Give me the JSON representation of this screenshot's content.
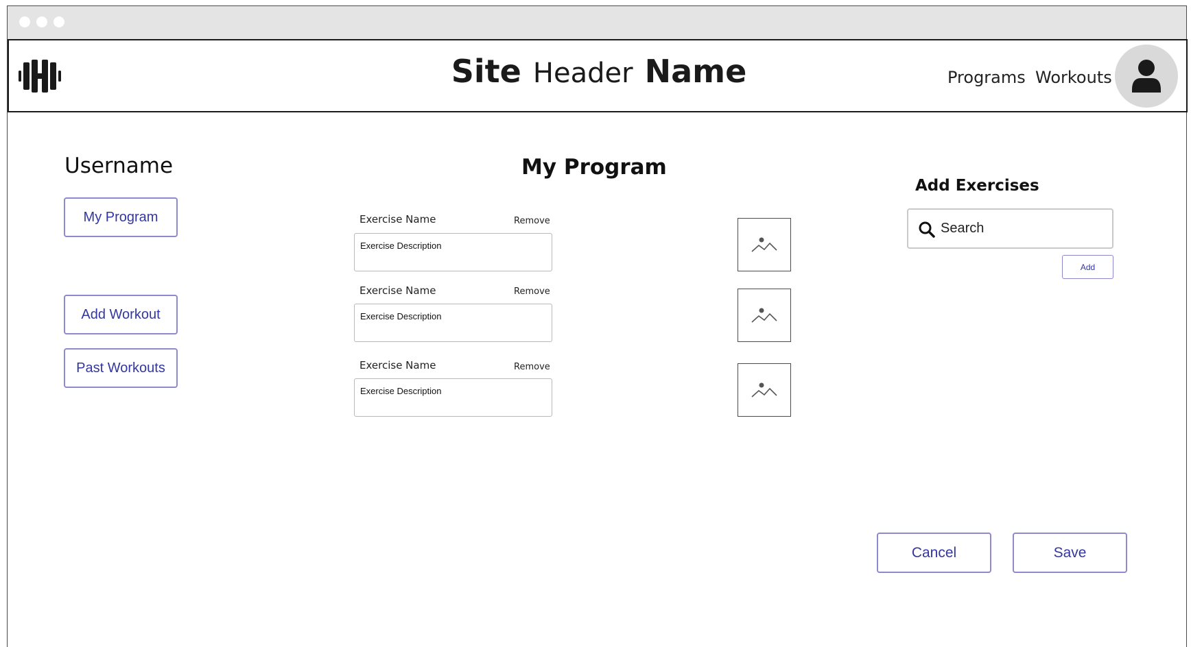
{
  "header": {
    "title_part1": "Site",
    "title_part2": "Header",
    "title_part3": "Name",
    "nav": [
      "Programs",
      "Workouts"
    ],
    "logo_icon": "dumbbell-icon",
    "avatar_icon": "user-icon"
  },
  "sidebar": {
    "username": "Username",
    "buttons": [
      "My Program",
      "Add Workout",
      "Past Workouts"
    ]
  },
  "program": {
    "title": "My Program",
    "exercises": [
      {
        "name": "Exercise Name",
        "remove_label": "Remove",
        "description": "Exercise Description"
      },
      {
        "name": "Exercise Name",
        "remove_label": "Remove",
        "description": "Exercise Description"
      },
      {
        "name": "Exercise Name",
        "remove_label": "Remove",
        "description": "Exercise Description"
      }
    ],
    "image_icon": "image-placeholder-icon"
  },
  "add_exercises": {
    "title": "Add Exercises",
    "search_placeholder": "Search",
    "add_label": "Add"
  },
  "actions": {
    "cancel_label": "Cancel",
    "save_label": "Save"
  },
  "colors": {
    "accent": "#3336a1",
    "button_border": "#8e88cf",
    "titlebar": "#e4e4e4",
    "avatar_bg": "#d9d9d9"
  }
}
